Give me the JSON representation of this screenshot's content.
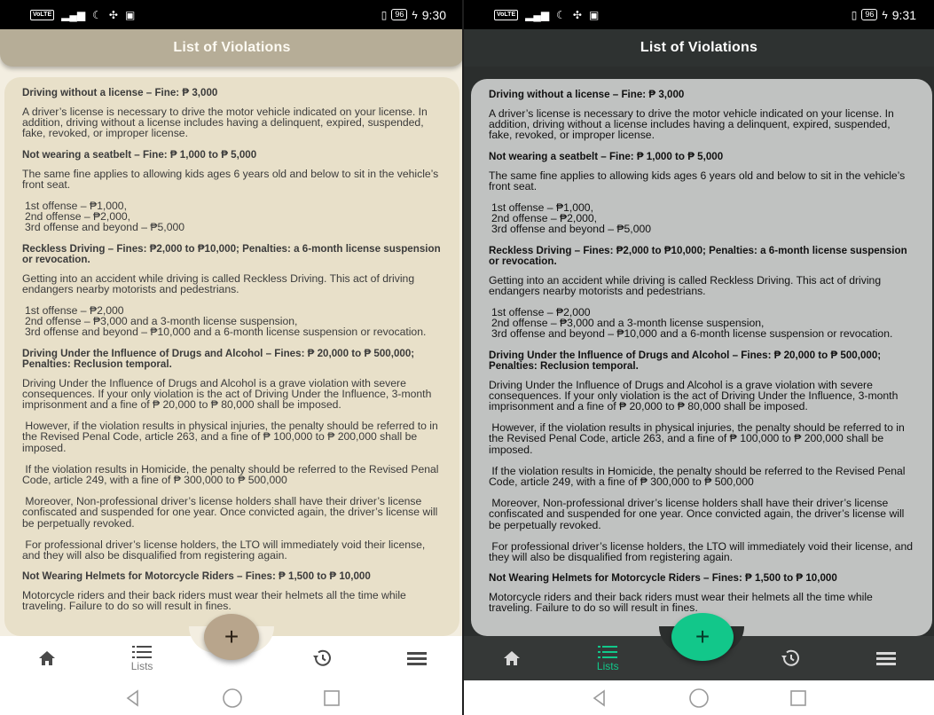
{
  "screens": [
    {
      "theme": "light",
      "status": {
        "volte": "VoLTE",
        "battery": "96",
        "time": "9:30"
      },
      "title": "List of Violations",
      "nav": {
        "lists_label": "Lists",
        "fab_label": "+"
      }
    },
    {
      "theme": "dark",
      "status": {
        "volte": "VoLTE",
        "battery": "96",
        "time": "9:31"
      },
      "title": "List of Violations",
      "nav": {
        "lists_label": "Lists",
        "fab_label": "+"
      }
    }
  ],
  "violations": [
    {
      "title": "Driving without a license – Fine: ₱ 3,000",
      "paras": [
        "A driver’s license is necessary to drive the motor vehicle indicated on your license. In addition, driving without a license includes having a delinquent, expired, suspended, fake, revoked, or improper license."
      ]
    },
    {
      "title": "Not wearing a seatbelt – Fine: ₱ 1,000 to ₱ 5,000",
      "paras": [
        "The same fine applies to allowing kids ages 6 years old and below to sit in the vehicle’s front seat."
      ],
      "offenses": [
        "1st offense – ₱1,000,",
        "2nd offense – ₱2,000,",
        "3rd offense and beyond – ₱5,000"
      ]
    },
    {
      "title": "Reckless Driving – Fines: ₱2,000 to ₱10,000; Penalties: a 6-month license suspension or revocation.",
      "paras": [
        "Getting into an accident while driving is called Reckless Driving. This act of driving endangers nearby motorists and pedestrians."
      ],
      "offenses": [
        "1st offense – ₱2,000",
        "2nd offense – ₱3,000 and a 3-month license suspension,",
        "3rd offense and beyond – ₱10,000 and a 6-month license suspension or revocation."
      ]
    },
    {
      "title": "Driving Under the Influence of Drugs and Alcohol – Fines: ₱ 20,000 to ₱ 500,000; Penalties: Reclusion temporal.",
      "paras": [
        "Driving Under the Influence of Drugs and Alcohol is a grave violation with severe consequences. If your only violation is the act of Driving Under the Influence, 3-month imprisonment and a fine of ₱ 20,000 to ₱ 80,000 shall be imposed.",
        " However, if the violation results in physical injuries, the penalty should be referred to in the Revised Penal Code, article 263, and a fine of ₱ 100,000 to ₱ 200,000 shall be imposed.",
        " If the violation results in Homicide, the penalty should be referred to the Revised Penal Code, article 249, with a fine of ₱ 300,000 to ₱ 500,000",
        " Moreover, Non-professional driver’s license holders shall have their driver’s license confiscated and suspended for one year. Once convicted again, the driver’s license will be perpetually revoked.",
        " For professional driver’s license holders, the LTO will immediately void their license, and they will also be disqualified from registering again."
      ]
    },
    {
      "title": "Not Wearing Helmets for Motorcycle Riders – Fines: ₱ 1,500 to ₱ 10,000",
      "paras": [
        "Motorcycle riders and their back riders must wear their helmets all the time while traveling. Failure to do so will result in fines."
      ]
    }
  ],
  "icons": {
    "home": "home-icon",
    "lists": "list-icon",
    "history": "history-icon",
    "menu": "menu-icon",
    "add": "plus-icon"
  },
  "colors": {
    "light_bg": "#e8e0c9",
    "light_header": "#b6ad97",
    "light_fab": "#b8a58c",
    "dark_bg": "#c0c2c1",
    "dark_header": "#2e3231",
    "dark_fab": "#12c78a"
  }
}
